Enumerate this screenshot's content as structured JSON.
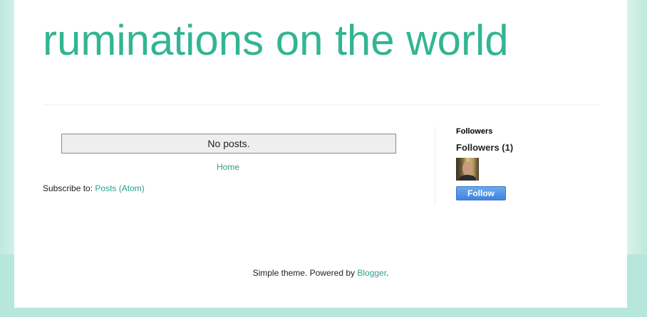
{
  "header": {
    "blog_title": "ruminations on the world"
  },
  "main": {
    "no_posts_text": "No posts.",
    "home_link": "Home",
    "subscribe_label": "Subscribe to:",
    "subscribe_link": "Posts (Atom)"
  },
  "sidebar": {
    "widget_heading": "Followers",
    "followers_count": "Followers (1)",
    "follow_button": "Follow"
  },
  "footer": {
    "text": "Simple theme. Powered by",
    "link": "Blogger",
    "trailing": "."
  },
  "colors": {
    "accent": "#32b592",
    "link": "#2aa289",
    "follow_button": "#4a8ee6",
    "background_band": "#b6e7da"
  }
}
